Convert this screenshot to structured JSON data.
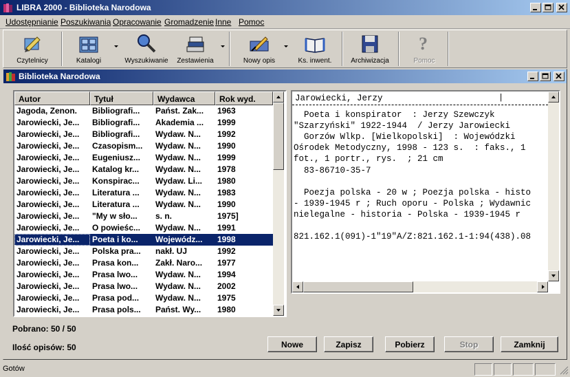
{
  "app": {
    "title": "LIBRA 2000 - Biblioteka Narodowa"
  },
  "menu": [
    "Udostępnianie",
    "Poszukiwania",
    "Opracowanie",
    "Gromadzenie",
    "Inne",
    "Pomoc"
  ],
  "toolbar": [
    {
      "label": "Czytelnicy",
      "icon": "reader-icon"
    },
    {
      "label": "Katalogi",
      "icon": "catalog-icon"
    },
    {
      "label": "Wyszukiwanie",
      "icon": "magnifier-icon"
    },
    {
      "label": "Zestawienia",
      "icon": "stack-icon"
    },
    {
      "label": "Nowy opis",
      "icon": "write-icon"
    },
    {
      "label": "Ks. inwent.",
      "icon": "book-icon"
    },
    {
      "label": "Archiwizacja",
      "icon": "floppy-icon"
    },
    {
      "label": "Pomoc",
      "icon": "help-icon"
    }
  ],
  "child_window": {
    "title": "Biblioteka Narodowa"
  },
  "list": {
    "columns": [
      "Autor",
      "Tytuł",
      "Wydawca",
      "Rok wyd."
    ],
    "rows": [
      [
        "Jagoda, Zenon.",
        "Bibliografi...",
        "Państ. Zak...",
        "1963"
      ],
      [
        "Jarowiecki, Je...",
        "Bibliografi...",
        "Akademia ...",
        "1999"
      ],
      [
        "Jarowiecki, Je...",
        "Bibliografi...",
        "Wydaw. N...",
        "1992"
      ],
      [
        "Jarowiecki, Je...",
        "Czasopism...",
        "Wydaw. N...",
        "1990"
      ],
      [
        "Jarowiecki, Je...",
        "Eugeniusz...",
        "Wydaw. N...",
        "1999"
      ],
      [
        "Jarowiecki, Je...",
        "Katalog kr...",
        "Wydaw. N...",
        "1978"
      ],
      [
        "Jarowiecki, Je...",
        "Konspirac...",
        "Wydaw. Li...",
        "1980"
      ],
      [
        "Jarowiecki, Je...",
        "Literatura ...",
        "Wydaw. N...",
        "1983"
      ],
      [
        "Jarowiecki, Je...",
        "Literatura ...",
        "Wydaw. N...",
        "1990"
      ],
      [
        "Jarowiecki, Je...",
        "\"My w sło...",
        "s. n.",
        "1975]"
      ],
      [
        "Jarowiecki, Je...",
        "O powieśc...",
        "Wydaw. N...",
        "1991"
      ],
      [
        "Jarowiecki, Je...",
        "Poeta i ko...",
        "Wojewódz...",
        "1998"
      ],
      [
        "Jarowiecki, Je...",
        "Polska pra...",
        "nakł. UJ",
        "1992"
      ],
      [
        "Jarowiecki, Je...",
        "Prasa kon...",
        "Zakł. Naro...",
        "1977"
      ],
      [
        "Jarowiecki, Je...",
        "Prasa lwo...",
        "Wydaw. N...",
        "1994"
      ],
      [
        "Jarowiecki, Je...",
        "Prasa lwo...",
        "Wydaw. N...",
        "2002"
      ],
      [
        "Jarowiecki, Je...",
        "Prasa pod...",
        "Wydaw. N...",
        "1975"
      ],
      [
        "Jarowiecki, Je...",
        "Prasa pols...",
        "Państ. Wy...",
        "1980"
      ]
    ],
    "selected_index": 11
  },
  "detail": {
    "heading": "Jarowiecki, Jerzy",
    "cursor": "|",
    "lines": [
      "  Poeta i konspirator  : Jerzy Szewczyk",
      "\"Szarzyński\" 1922-1944  / Jerzy Jarowiecki",
      "  Gorzów Wlkp. [Wielkopolski]  : Wojewódzki",
      "Ośrodek Metodyczny, 1998 - 123 s.  : faks., 1",
      "fot., 1 portr., rys.  ; 21 cm",
      "  83-86710-35-7",
      "",
      "  Poezja polska - 20 w ; Poezja polska - histo",
      "- 1939-1945 r ; Ruch oporu - Polska ; Wydawnic",
      "nielegalne - historia - Polska - 1939-1945 r",
      "",
      "821.162.1(091)-1\"19\"A/Z:821.162.1-1:94(438).08"
    ]
  },
  "counts": {
    "pobrano": "Pobrano: 50 / 50",
    "opisow": "Ilość opisów: 50"
  },
  "buttons": {
    "nowe": "Nowe",
    "zapisz": "Zapisz",
    "pobierz": "Pobierz",
    "stop": "Stop",
    "zamknij": "Zamknij"
  },
  "statusbar": {
    "text": "Gotów"
  },
  "colors": {
    "selection": "#0a246a",
    "face": "#d4d0c8"
  }
}
